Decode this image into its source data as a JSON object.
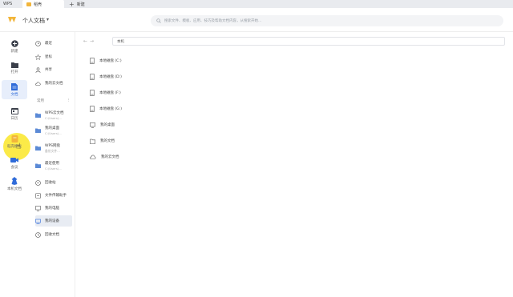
{
  "titlebar": {
    "tabs": [
      {
        "label": "WPS"
      },
      {
        "label": "稻壳"
      },
      {
        "label": "新建"
      }
    ]
  },
  "header": {
    "title": "个人文档",
    "search_placeholder": "搜索文件、模板、应用、技巧及帮助文档内容，从搜索开始..."
  },
  "rail": {
    "items": [
      {
        "label": "新建",
        "icon": "plus-circle-icon"
      },
      {
        "label": "打开",
        "icon": "folder-open-icon"
      },
      {
        "label": "文档",
        "icon": "document-icon",
        "active": true
      },
      {
        "label": "日历",
        "icon": "calendar-icon"
      },
      {
        "label": "稻壳模板",
        "icon": "template-icon"
      },
      {
        "label": "会议",
        "icon": "meeting-icon"
      },
      {
        "label": "本机文档",
        "icon": "device-icon"
      }
    ]
  },
  "col2": {
    "items": [
      {
        "label": "最近",
        "icon": "clock-icon"
      },
      {
        "label": "星标",
        "icon": "star-icon"
      },
      {
        "label": "共享",
        "icon": "share-icon"
      },
      {
        "label": "我的云文档",
        "icon": "cloud-icon"
      }
    ],
    "section_label": "常用",
    "pinned": [
      {
        "label": "WPS云文档",
        "sub": "C:\\Users\\..."
      },
      {
        "label": "我的桌面",
        "sub": "C:\\Users\\..."
      },
      {
        "label": "WPS网盘",
        "sub": "备份文件..."
      },
      {
        "label": "最近使用",
        "sub": "C:\\Users\\..."
      }
    ],
    "bottom": [
      {
        "label": "回收站",
        "icon": "trash-icon"
      },
      {
        "label": "文件传输助手",
        "icon": "transfer-icon"
      },
      {
        "label": "我的电脑",
        "icon": "computer-icon"
      },
      {
        "label": "我的设备",
        "icon": "device-icon",
        "selected": true
      },
      {
        "label": "回收文档",
        "icon": "recycle-icon"
      }
    ]
  },
  "path": {
    "label": "本机"
  },
  "list": [
    {
      "label": "本地磁盘 (C:)",
      "icon": "drive-icon"
    },
    {
      "label": "本地磁盘 (D:)",
      "icon": "drive-icon"
    },
    {
      "label": "本地磁盘 (F:)",
      "icon": "drive-icon"
    },
    {
      "label": "本地磁盘 (G:)",
      "icon": "drive-icon"
    },
    {
      "label": "我的桌面",
      "icon": "desktop-icon"
    },
    {
      "label": "我的文档",
      "icon": "folder-icon"
    },
    {
      "label": "我的云文档",
      "icon": "cloud-icon"
    }
  ]
}
